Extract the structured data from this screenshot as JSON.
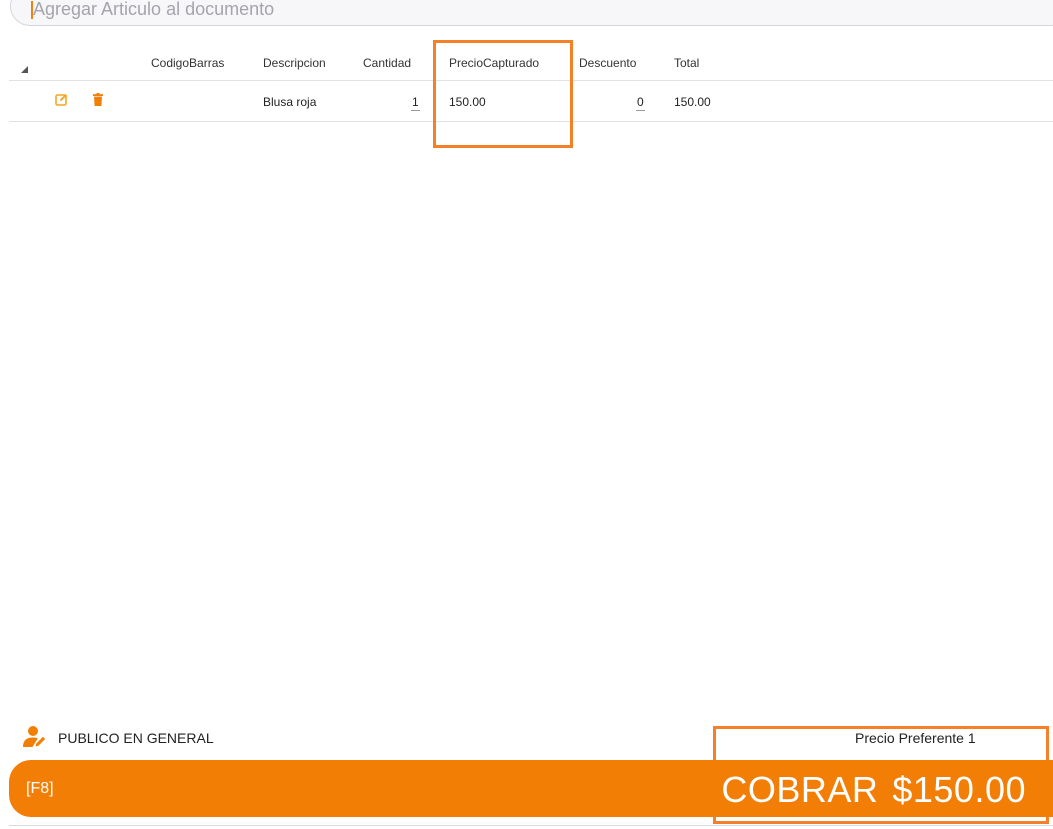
{
  "search": {
    "placeholder": "Agregar Articulo al documento"
  },
  "grid": {
    "columns": [
      "CodigoBarras",
      "Descripcion",
      "Cantidad",
      "PrecioCapturado",
      "Descuento",
      "Total"
    ],
    "rows": [
      {
        "codigo_barras": "",
        "descripcion": "Blusa roja",
        "cantidad": "1",
        "precio_capturado": "150.00",
        "descuento": "0",
        "total": "150.00",
        "actions": [
          "edit-icon",
          "trash-icon"
        ]
      }
    ]
  },
  "customer": {
    "icon": "user-edit-icon",
    "name": "PUBLICO EN GENERAL"
  },
  "price_level": "Precio Preferente 1",
  "pay": {
    "shortcut": "[F8]",
    "label": "COBRAR",
    "amount": "$150.00"
  },
  "colors": {
    "accent": "#f27e06",
    "highlight": "#f5802a"
  }
}
